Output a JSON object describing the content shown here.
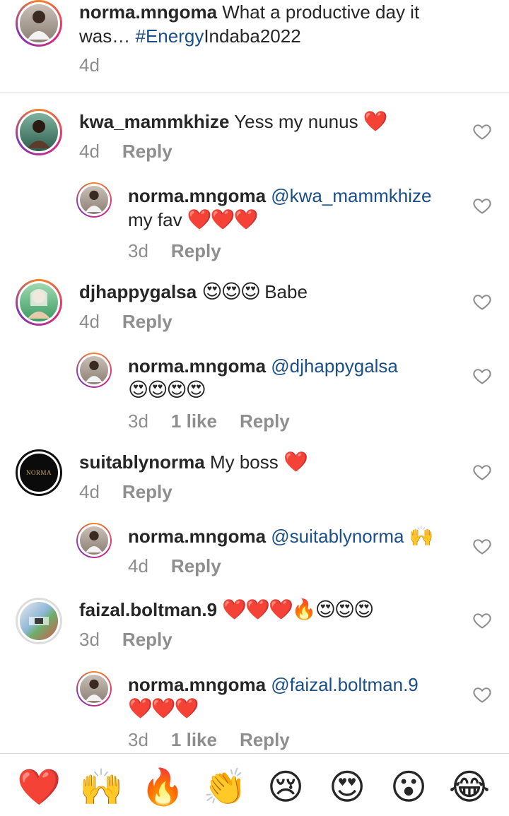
{
  "post": {
    "username": "norma.mngoma",
    "caption_part1": "What a productive day it",
    "caption_part2_prefix": "was…",
    "hashtag": "#Energy",
    "caption_part2_suffix": "Indaba2022",
    "time": "4d"
  },
  "comments": [
    {
      "username": "kwa_mammkhize",
      "text": "Yess my nunus",
      "emoji": "❤️",
      "time": "4d",
      "reply_label": "Reply",
      "reply": {
        "username": "norma.mngoma",
        "mention": "@kwa_mammkhize",
        "text": "my fav",
        "emoji": "❤️❤️❤️",
        "time": "3d",
        "reply_label": "Reply"
      }
    },
    {
      "username": "djhappygalsa",
      "text": "Babe",
      "emoji": "😍😍😍",
      "time": "4d",
      "reply_label": "Reply",
      "reply": {
        "username": "norma.mngoma",
        "mention": "@djhappygalsa",
        "emoji": "😍😍😍😍",
        "time": "3d",
        "likes": "1 like",
        "reply_label": "Reply"
      }
    },
    {
      "username": "suitablynorma",
      "text": "My boss",
      "emoji": "❤️",
      "time": "4d",
      "reply_label": "Reply",
      "avatar_text": "NORMA",
      "reply": {
        "username": "norma.mngoma",
        "mention": "@suitablynorma",
        "emoji": "🙌",
        "time": "4d",
        "reply_label": "Reply"
      }
    },
    {
      "username": "faizal.boltman.9",
      "emoji": "❤️❤️❤️🔥😍😍😍",
      "time": "3d",
      "reply_label": "Reply",
      "reply": {
        "username": "norma.mngoma",
        "mention": "@faizal.boltman.9",
        "emoji": "❤️❤️❤️",
        "time": "3d",
        "likes": "1 like",
        "reply_label": "Reply"
      }
    }
  ],
  "quick_reactions": [
    "❤️",
    "🙌",
    "🔥",
    "👏",
    "😢",
    "😍",
    "😮",
    "😂"
  ],
  "colors": {
    "mention": "#1b4f8a",
    "meta": "#8e8e8e",
    "divider": "#dbdbdb",
    "heart": "#e0245e"
  }
}
